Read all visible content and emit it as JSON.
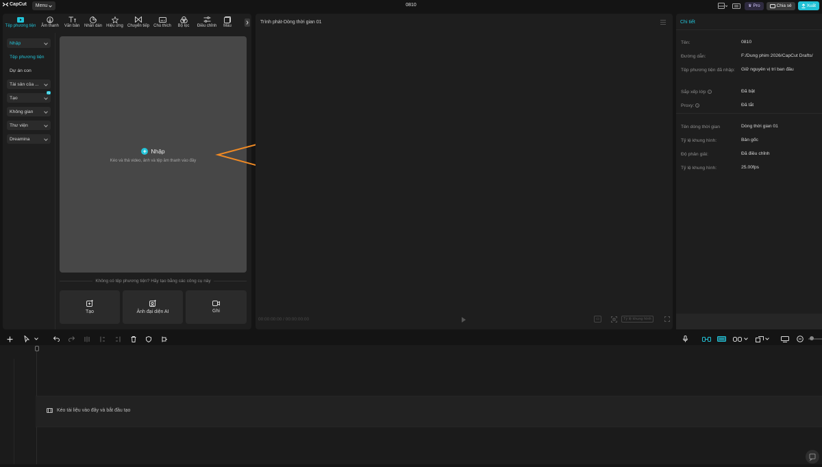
{
  "app": {
    "name": "CapCut",
    "menu_label": "Menu",
    "project_title": "0810"
  },
  "titlebar": {
    "pro_label": "Pro",
    "share_label": "Chia sẻ",
    "export_label": "Xuất"
  },
  "toolbar": {
    "items": [
      {
        "label": "Tệp phương tiện",
        "icon": "media-icon",
        "active": true
      },
      {
        "label": "Âm thanh",
        "icon": "audio-icon"
      },
      {
        "label": "Văn bản",
        "icon": "text-icon"
      },
      {
        "label": "Nhãn dán",
        "icon": "sticker-icon"
      },
      {
        "label": "Hiệu ứng",
        "icon": "effects-icon"
      },
      {
        "label": "Chuyển tiếp",
        "icon": "transition-icon"
      },
      {
        "label": "Chú thích",
        "icon": "caption-icon"
      },
      {
        "label": "Bộ lọc",
        "icon": "filter-icon"
      },
      {
        "label": "Điều chỉnh",
        "icon": "adjust-icon"
      },
      {
        "label": "Mẫu",
        "icon": "template-icon"
      }
    ]
  },
  "sidenav": {
    "items": [
      {
        "label": "Nhập",
        "dropdown": true,
        "active": true
      },
      {
        "label": "Tệp phương tiện",
        "active_text": true
      },
      {
        "label": "Dự án con"
      },
      {
        "label": "Tài sản của ...",
        "dropdown": true
      },
      {
        "label": "Tạo",
        "dropdown": true,
        "badge": "AI"
      },
      {
        "label": "Không gian",
        "dropdown": true
      },
      {
        "label": "Thư viện",
        "dropdown": true
      },
      {
        "label": "Dreamina",
        "button": true
      }
    ]
  },
  "media": {
    "import_title": "Nhập",
    "import_hint": "Kéo và thả video, ảnh và tệp âm thanh vào đây",
    "empty_hint": "Không có tệp phương tiện? Hãy tạo bằng các công cụ này",
    "cards": [
      {
        "label": "Tạo",
        "icon": "create-icon"
      },
      {
        "label": "Ảnh đại diện AI",
        "icon": "ai-avatar-icon"
      },
      {
        "label": "Ghi",
        "icon": "record-icon"
      }
    ]
  },
  "player": {
    "title": "Trình phát-Dòng thời gian 01",
    "timecode": "00:00:00:00 / 00:00:00:00",
    "ratio_label": "Tỷ lệ khung hình"
  },
  "details": {
    "title": "Chi tiết",
    "rows": [
      {
        "label": "Tên:",
        "value": "0810"
      },
      {
        "label": "Đường dẫn:",
        "value": "F:/Dung phim 2026/CapCut Drafts/"
      },
      {
        "label": "Tệp phương tiện đã nhập:",
        "value": "Giữ nguyên vị trí ban đầu"
      },
      {
        "label": "Sắp xếp lớp",
        "value": "Đã bật",
        "help": true
      },
      {
        "label": "Proxy:",
        "value": "Đã tắt",
        "help": true
      },
      {
        "label": "Tên dòng thời gian",
        "value": "Dòng thời gian 01"
      },
      {
        "label": "Tỷ lệ khung hình:",
        "value": "Bản gốc"
      },
      {
        "label": "Độ phân giải:",
        "value": "Đã điều chỉnh"
      },
      {
        "label": "Tỷ lệ khung hình:",
        "value": "25.00fps"
      }
    ]
  },
  "timeline": {
    "drop_hint": "Kéo tài liệu vào đây và bắt đầu tạo"
  },
  "colors": {
    "accent": "#22c4d9",
    "annotation_arrow": "#f08a24",
    "background": "#141414",
    "panel": "#1e1e1e"
  }
}
